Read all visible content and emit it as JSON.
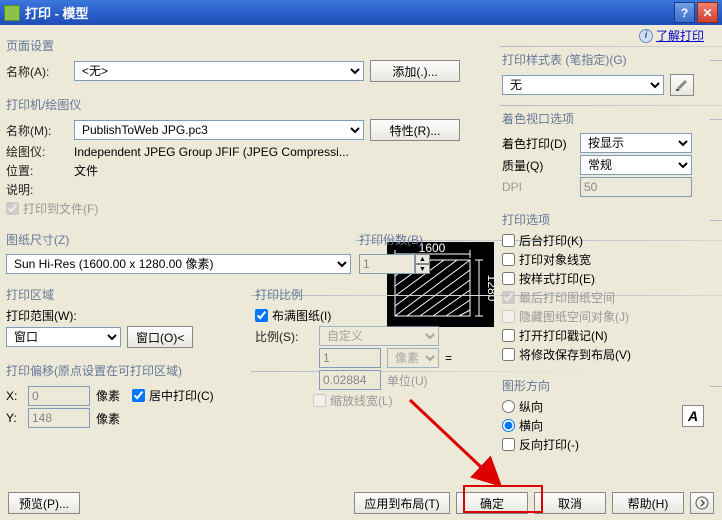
{
  "window": {
    "title": "打印 - 模型"
  },
  "help": {
    "text": "了解打印"
  },
  "page_setup": {
    "title": "页面设置",
    "name_label": "名称(A):",
    "name_value": "<无>",
    "add_btn": "添加(.)..."
  },
  "printer": {
    "title": "打印机/绘图仪",
    "name_label": "名称(M):",
    "name_value": "PublishToWeb JPG.pc3",
    "props_btn": "特性(R)...",
    "plotter_label": "绘图仪:",
    "plotter_value": "Independent JPEG Group JFIF (JPEG Compressi...",
    "location_label": "位置:",
    "location_value": "文件",
    "desc_label": "说明:",
    "desc_value": "",
    "to_file_label": "打印到文件(F)",
    "preview_w": "1600",
    "preview_h": "1280"
  },
  "paper": {
    "title": "图纸尺寸(Z)",
    "value": "Sun Hi-Res (1600.00 x 1280.00 像素)"
  },
  "copies": {
    "title": "打印份数(B)",
    "value": "1"
  },
  "area": {
    "title": "打印区域",
    "scope_label": "打印范围(W):",
    "scope_value": "窗口",
    "window_btn": "窗口(O)<"
  },
  "offset": {
    "title": "打印偏移(原点设置在可打印区域)",
    "x_label": "X:",
    "x_value": "0",
    "x_unit": "像素",
    "y_label": "Y:",
    "y_value": "148",
    "y_unit": "像素",
    "center_label": "居中打印(C)"
  },
  "scale": {
    "title": "打印比例",
    "fit_label": "布满图纸(I)",
    "scale_label": "比例(S):",
    "scale_value": "自定义",
    "num_value": "1",
    "num_unit": "像素",
    "eq": "=",
    "den_value": "0.02884",
    "den_unit": "单位(U)",
    "lw_label": "缩放线宽(L)"
  },
  "style": {
    "title": "打印样式表 (笔指定)(G)",
    "value": "无"
  },
  "viewport": {
    "title": "着色视口选项",
    "shade_label": "着色打印(D)",
    "shade_value": "按显示",
    "quality_label": "质量(Q)",
    "quality_value": "常规",
    "dpi_label": "DPI",
    "dpi_value": "50"
  },
  "options": {
    "title": "打印选项",
    "items": [
      "后台打印(K)",
      "打印对象线宽",
      "按样式打印(E)",
      "最后打印图纸空间",
      "隐藏图纸空间对象(J)",
      "打开打印戳记(N)",
      "将修改保存到布局(V)"
    ]
  },
  "orient": {
    "title": "图形方向",
    "portrait": "纵向",
    "landscape": "横向",
    "reverse": "反向打印(-)"
  },
  "footer": {
    "preview": "预览(P)...",
    "apply": "应用到布局(T)",
    "ok": "确定",
    "cancel": "取消",
    "help": "帮助(H)"
  }
}
